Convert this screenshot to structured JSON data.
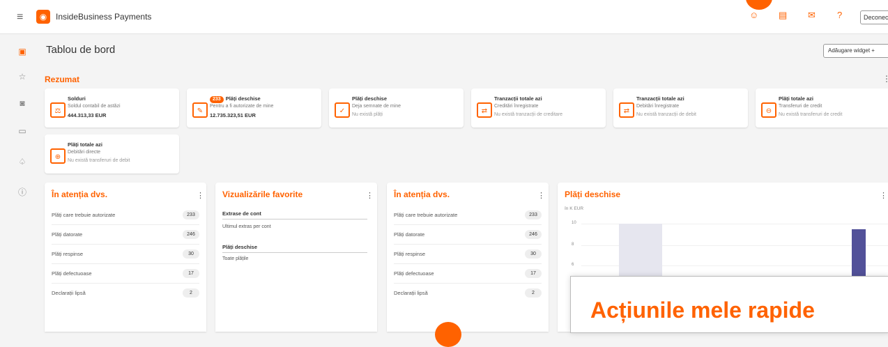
{
  "header": {
    "menu_icon": "hamburger-icon",
    "app_title": "InsideBusiness Payments",
    "logout_label": "Deconectare",
    "icons": [
      "user-icon",
      "approvals-icon",
      "mail-icon",
      "help-icon"
    ],
    "accent_color": "#ff6200"
  },
  "sidebar": {
    "items": [
      "dashboard-icon",
      "star-icon",
      "wallet-icon",
      "card-icon",
      "bell-icon",
      "info-icon"
    ]
  },
  "page": {
    "title": "Tablou de bord",
    "add_widget_label": "Adăugare widget  +"
  },
  "summary": {
    "section_title": "Rezumat",
    "cards": [
      {
        "title": "Solduri",
        "subtitle": "Soldul contabil de astăzi",
        "value": "444.313,33 EUR",
        "icon": "scale-icon"
      },
      {
        "title": "Plăți deschise",
        "badge": "233",
        "subtitle": "Pentru a fi autorizate de mine",
        "value": "12.735.323,51 EUR",
        "icon": "sign-document-icon"
      },
      {
        "title": "Plăți deschise",
        "subtitle": "Deja semnate de mine",
        "value": "Nu există plăți",
        "icon": "money-check-icon"
      },
      {
        "title": "Tranzacții totale azi",
        "subtitle": "Creditări înregistrate",
        "value": "Nu există tranzacții de creditare",
        "icon": "transfer-plus-icon"
      },
      {
        "title": "Tranzacții totale azi",
        "subtitle": "Debitări înregistrate",
        "value": "Nu există tranzacții de debit",
        "icon": "transfer-minus-icon"
      },
      {
        "title": "Plăți totale azi",
        "subtitle": "Transferuri de credit",
        "value": "Nu există transferuri de credit",
        "icon": "money-minus-icon"
      },
      {
        "title": "Plăți totale azi",
        "subtitle": "Debitări directe",
        "value": "Nu există transferuri de debit",
        "icon": "money-plus-icon"
      }
    ]
  },
  "attention1": {
    "title": "În atenția dvs.",
    "rows": [
      {
        "label": "Plăți care trebuie autorizate",
        "count": "233"
      },
      {
        "label": "Plăți datorate",
        "count": "246"
      },
      {
        "label": "Plăți respinse",
        "count": "30"
      },
      {
        "label": "Plăți defectuoase",
        "count": "17"
      },
      {
        "label": "Declarații lipsă",
        "count": "2"
      }
    ]
  },
  "favorites": {
    "title": "Vizualizările favorite",
    "groups": [
      {
        "heading": "Extrase de cont",
        "link": "Ultimul extras per cont"
      },
      {
        "heading": "Plăți deschise",
        "link": "Toate plățile"
      }
    ]
  },
  "attention2": {
    "title": "În atenția dvs.",
    "rows": [
      {
        "label": "Plăți care trebuie autorizate",
        "count": "233"
      },
      {
        "label": "Plăți datorate",
        "count": "246"
      },
      {
        "label": "Plăți respinse",
        "count": "30"
      },
      {
        "label": "Plăți defectuoase",
        "count": "17"
      },
      {
        "label": "Declarații lipsă",
        "count": "2"
      }
    ]
  },
  "open_payments_chart": {
    "title": "Plăți deschise",
    "unit_label": "în K EUR"
  },
  "chart_data": {
    "type": "bar",
    "title": "Plăți deschise",
    "ylabel": "în K EUR",
    "y_ticks": [
      "10",
      "8",
      "6"
    ],
    "ylim": [
      0,
      10
    ],
    "series": [
      {
        "values": [
          10
        ],
        "color": "#e6e6ef"
      },
      {
        "values": [
          9.5
        ],
        "color": "#525199"
      }
    ]
  },
  "quick_actions_popup": {
    "title": "Acțiunile mele rapide"
  }
}
